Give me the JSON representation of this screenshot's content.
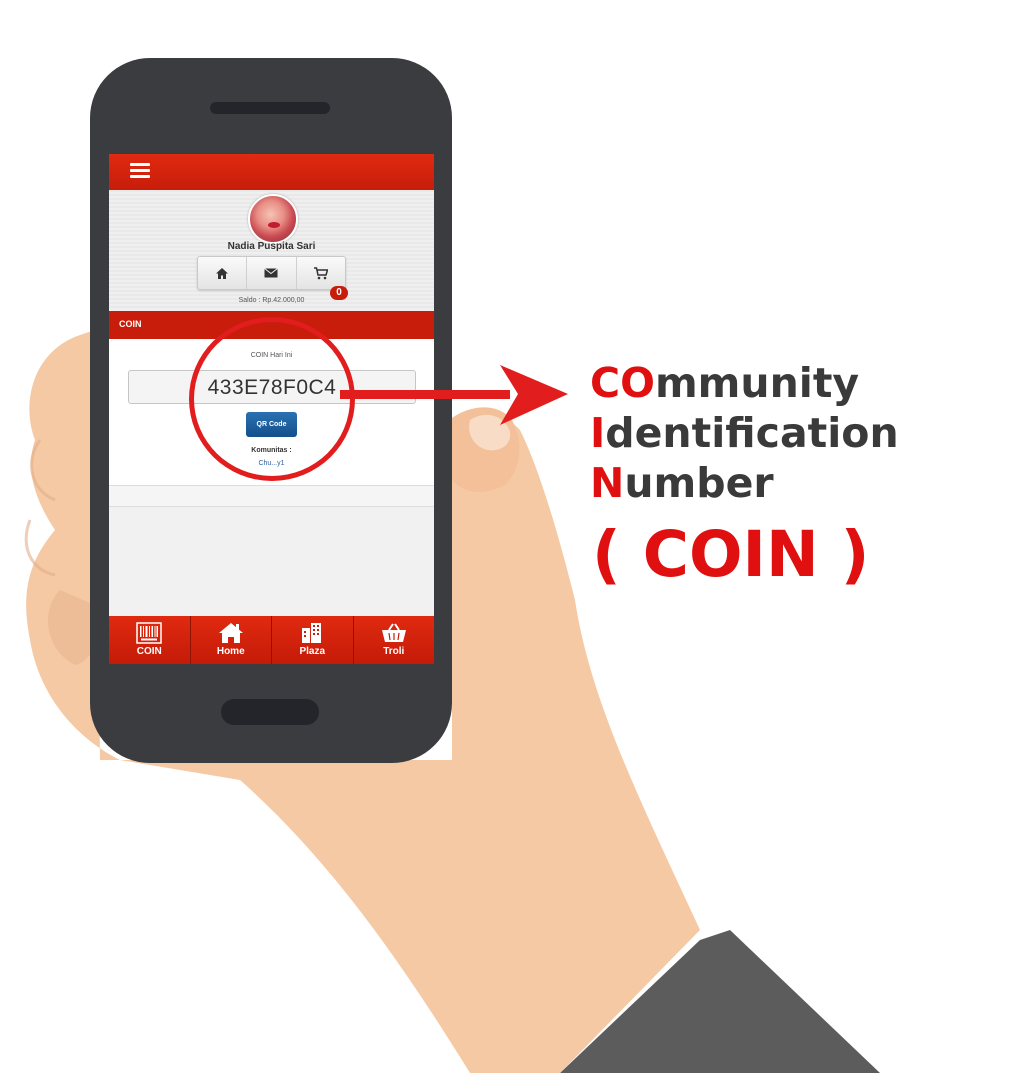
{
  "app": {
    "profile_name": "Nadia Puspita Sari",
    "cart_count": "0",
    "saldo": "Saldo : Rp.42.000,00"
  },
  "coin_section": {
    "title": "COIN",
    "today_label": "COIN Hari Ini",
    "code": "433E78F0C4",
    "qr_button": "QR Code",
    "komunitas_label": "Komunitas :",
    "komunitas_value": "Chu...y1"
  },
  "bottom_nav": [
    {
      "label": "COIN",
      "icon": "barcode-icon"
    },
    {
      "label": "Home",
      "icon": "home-icon"
    },
    {
      "label": "Plaza",
      "icon": "building-icon"
    },
    {
      "label": "Troli",
      "icon": "basket-icon"
    }
  ],
  "top_icons": [
    "home-icon",
    "envelope-icon",
    "cart-icon"
  ],
  "annotation": {
    "line1_highlight": "CO",
    "line1_rest": "mmunity",
    "line2_highlight": "I",
    "line2_rest": "dentification",
    "line3_highlight": "N",
    "line3_rest": "umber",
    "acronym": "( COIN )"
  },
  "colors": {
    "brand_red": "#c71d0a",
    "annotation_red": "#e01010",
    "skin": "#f5c9a4",
    "sleeve": "#5c5c5c",
    "phone_body": "#3b3c40"
  }
}
